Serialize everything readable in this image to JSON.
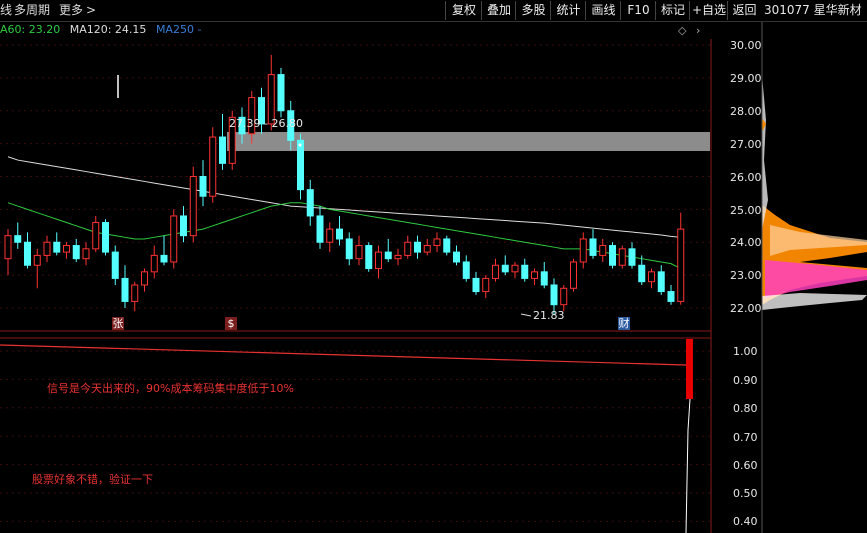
{
  "toolbar": {
    "left_items": [
      "线",
      "多周期",
      "更多"
    ],
    "right_buttons": [
      "复权",
      "叠加",
      "多股",
      "统计",
      "画线",
      "F10",
      "标记",
      "+自选",
      "返回"
    ],
    "stock_code_name": "301077 星华新材"
  },
  "legend": {
    "ma60": "A60: 23.20",
    "ma120": "MA120: 24.15",
    "ma250": "MA250 -",
    "colors": {
      "ma60": "#2ecc40",
      "ma120": "#dddddd",
      "ma250": "#3a7bd5"
    }
  },
  "price_axis": {
    "ticks": [
      "30.00",
      "29.00",
      "28.00",
      "27.00",
      "26.00",
      "25.00",
      "24.00",
      "23.00",
      "22.00"
    ],
    "high_label": "27.39 - 26.80",
    "low_label": "21.83",
    "markers": [
      {
        "text": "张",
        "bg": "#7a1e1e",
        "color": "#fff"
      },
      {
        "text": "$",
        "bg": "#7a1e1e",
        "color": "#fff"
      },
      {
        "text": "财",
        "bg": "#2a5aa0",
        "color": "#fff"
      }
    ]
  },
  "indicator_axis": {
    "ticks": [
      "1.00",
      "0.90",
      "0.80",
      "0.70",
      "0.60",
      "0.50",
      "0.40"
    ]
  },
  "notes": {
    "note1": "信号是今天出来的，90%成本筹码集中度低于10%",
    "note2": "股票好象不错，验证一下"
  },
  "colors": {
    "up": "#ff3232",
    "down": "#54ffff",
    "axis": "#8b1a1a",
    "zone": "#8c8c8c"
  },
  "chart_data": {
    "type": "candlestick",
    "y_range": [
      21.7,
      30.0
    ],
    "candles": [
      [
        23.5,
        24.4,
        23.0,
        24.2
      ],
      [
        24.2,
        24.6,
        23.8,
        24.0
      ],
      [
        24.0,
        24.3,
        23.2,
        23.3
      ],
      [
        23.3,
        23.8,
        22.6,
        23.6
      ],
      [
        23.6,
        24.2,
        23.4,
        24.0
      ],
      [
        24.0,
        24.3,
        23.6,
        23.7
      ],
      [
        23.7,
        24.0,
        23.5,
        23.9
      ],
      [
        23.9,
        24.1,
        23.4,
        23.5
      ],
      [
        23.5,
        24.0,
        23.3,
        23.8
      ],
      [
        23.8,
        24.8,
        23.7,
        24.6
      ],
      [
        24.6,
        24.7,
        23.6,
        23.7
      ],
      [
        23.7,
        23.9,
        22.7,
        22.9
      ],
      [
        22.9,
        23.3,
        22.0,
        22.2
      ],
      [
        22.2,
        22.8,
        21.9,
        22.7
      ],
      [
        22.7,
        23.2,
        22.5,
        23.1
      ],
      [
        23.1,
        23.9,
        22.9,
        23.6
      ],
      [
        23.6,
        24.2,
        23.3,
        23.4
      ],
      [
        23.4,
        25.0,
        23.2,
        24.8
      ],
      [
        24.8,
        25.1,
        24.0,
        24.2
      ],
      [
        24.2,
        26.3,
        24.0,
        26.0
      ],
      [
        26.0,
        26.5,
        25.1,
        25.4
      ],
      [
        25.4,
        27.5,
        25.2,
        27.2
      ],
      [
        27.2,
        27.9,
        26.2,
        26.4
      ],
      [
        26.4,
        28.0,
        26.2,
        27.8
      ],
      [
        27.8,
        28.1,
        27.0,
        27.3
      ],
      [
        27.3,
        28.6,
        27.0,
        28.4
      ],
      [
        28.4,
        28.7,
        27.3,
        27.6
      ],
      [
        27.6,
        29.7,
        27.4,
        29.1
      ],
      [
        29.1,
        29.3,
        27.8,
        28.0
      ],
      [
        28.0,
        28.3,
        26.8,
        27.1
      ],
      [
        27.1,
        27.3,
        25.3,
        25.6
      ],
      [
        25.6,
        25.9,
        24.5,
        24.8
      ],
      [
        24.8,
        25.1,
        23.8,
        24.0
      ],
      [
        24.0,
        24.6,
        23.7,
        24.4
      ],
      [
        24.4,
        24.8,
        23.9,
        24.1
      ],
      [
        24.1,
        24.3,
        23.3,
        23.5
      ],
      [
        23.5,
        24.2,
        23.3,
        23.9
      ],
      [
        23.9,
        24.0,
        23.1,
        23.2
      ],
      [
        23.2,
        23.9,
        22.9,
        23.7
      ],
      [
        23.7,
        24.1,
        23.4,
        23.5
      ],
      [
        23.5,
        23.8,
        23.3,
        23.6
      ],
      [
        23.6,
        24.2,
        23.5,
        24.0
      ],
      [
        24.0,
        24.2,
        23.5,
        23.7
      ],
      [
        23.7,
        24.1,
        23.6,
        23.9
      ],
      [
        23.9,
        24.3,
        23.7,
        24.1
      ],
      [
        24.1,
        24.2,
        23.6,
        23.7
      ],
      [
        23.7,
        23.9,
        23.3,
        23.4
      ],
      [
        23.4,
        23.6,
        22.8,
        22.9
      ],
      [
        22.9,
        23.1,
        22.4,
        22.5
      ],
      [
        22.5,
        23.0,
        22.3,
        22.9
      ],
      [
        22.9,
        23.5,
        22.8,
        23.3
      ],
      [
        23.3,
        23.6,
        23.0,
        23.1
      ],
      [
        23.1,
        23.4,
        22.9,
        23.3
      ],
      [
        23.3,
        23.5,
        22.8,
        22.9
      ],
      [
        22.9,
        23.2,
        22.7,
        23.1
      ],
      [
        23.1,
        23.4,
        22.6,
        22.7
      ],
      [
        22.7,
        22.9,
        21.8,
        22.1
      ],
      [
        22.1,
        22.7,
        21.9,
        22.6
      ],
      [
        22.6,
        23.5,
        22.5,
        23.4
      ],
      [
        23.4,
        24.3,
        23.2,
        24.1
      ],
      [
        24.1,
        24.4,
        23.5,
        23.6
      ],
      [
        23.6,
        24.1,
        23.4,
        23.9
      ],
      [
        23.9,
        24.0,
        23.2,
        23.3
      ],
      [
        23.3,
        23.9,
        23.2,
        23.8
      ],
      [
        23.8,
        24.0,
        23.2,
        23.3
      ],
      [
        23.3,
        23.6,
        22.7,
        22.8
      ],
      [
        22.8,
        23.2,
        22.6,
        23.1
      ],
      [
        23.1,
        23.3,
        22.4,
        22.5
      ],
      [
        22.5,
        22.7,
        22.1,
        22.2
      ],
      [
        22.2,
        24.9,
        22.1,
        24.4
      ]
    ],
    "ma60": [
      25.2,
      25.1,
      25.0,
      24.9,
      24.8,
      24.7,
      24.6,
      24.5,
      24.4,
      24.3,
      24.25,
      24.2,
      24.15,
      24.1,
      24.1,
      24.15,
      24.2,
      24.25,
      24.3,
      24.35,
      24.4,
      24.5,
      24.6,
      24.7,
      24.8,
      24.9,
      25.0,
      25.1,
      25.15,
      25.2,
      25.2,
      25.15,
      25.1,
      25.0,
      24.95,
      24.9,
      24.85,
      24.8,
      24.75,
      24.7,
      24.65,
      24.6,
      24.55,
      24.5,
      24.45,
      24.4,
      24.35,
      24.3,
      24.25,
      24.2,
      24.15,
      24.1,
      24.05,
      24.0,
      23.95,
      23.9,
      23.85,
      23.8,
      23.8,
      23.8,
      23.75,
      23.7,
      23.65,
      23.6,
      23.55,
      23.5,
      23.45,
      23.4,
      23.35,
      23.2
    ],
    "ma120": [
      26.6,
      26.5,
      26.45,
      26.4,
      26.35,
      26.3,
      26.25,
      26.2,
      26.15,
      26.1,
      26.05,
      26.0,
      25.95,
      25.9,
      25.85,
      25.8,
      25.75,
      25.7,
      25.65,
      25.6,
      25.55,
      25.5,
      25.45,
      25.4,
      25.35,
      25.3,
      25.25,
      25.2,
      25.15,
      25.1,
      25.08,
      25.06,
      25.04,
      25.02,
      25.0,
      24.98,
      24.96,
      24.94,
      24.92,
      24.9,
      24.88,
      24.86,
      24.84,
      24.82,
      24.8,
      24.78,
      24.76,
      24.74,
      24.72,
      24.7,
      24.68,
      24.66,
      24.64,
      24.62,
      24.6,
      24.58,
      24.55,
      24.52,
      24.49,
      24.46,
      24.43,
      24.4,
      24.37,
      24.34,
      24.31,
      24.28,
      24.25,
      24.22,
      24.18,
      24.15
    ],
    "indicator_line": [
      0.98,
      0.978,
      0.976,
      0.974,
      0.972,
      0.97,
      0.968,
      0.966,
      0.964,
      0.962,
      0.96
    ]
  }
}
